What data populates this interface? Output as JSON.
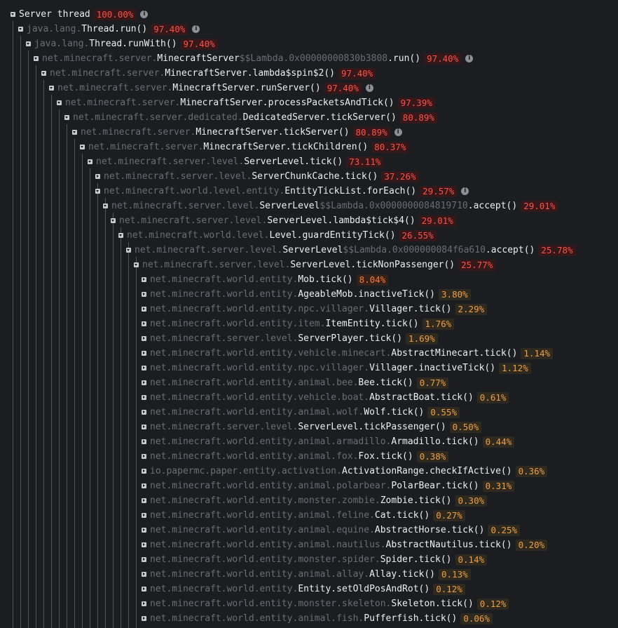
{
  "info_icon_glyph": "i",
  "colors": {
    "background": "#1b1d21",
    "percent_high": "#ff5147",
    "percent_mid": "#ff7a33",
    "percent_low": "#ee9f46",
    "package_text": "#6a6e75",
    "class_text": "#eceff2"
  },
  "nodes": [
    {
      "depth": 0,
      "expanded": true,
      "pkg": "",
      "cls": "Server thread",
      "lam": "",
      "meth": "",
      "pct": "100.00%",
      "info": true
    },
    {
      "depth": 1,
      "expanded": true,
      "pkg": "java.lang.",
      "cls": "Thread",
      "lam": "",
      "meth": ".run()",
      "pct": "97.40%",
      "info": true
    },
    {
      "depth": 2,
      "expanded": true,
      "pkg": "java.lang.",
      "cls": "Thread",
      "lam": "",
      "meth": ".runWith()",
      "pct": "97.40%",
      "info": false
    },
    {
      "depth": 3,
      "expanded": true,
      "pkg": "net.minecraft.server.",
      "cls": "MinecraftServer",
      "lam": "$$Lambda.0x00000000830b3808",
      "meth": ".run()",
      "pct": "97.40%",
      "info": true
    },
    {
      "depth": 4,
      "expanded": true,
      "pkg": "net.minecraft.server.",
      "cls": "MinecraftServer",
      "lam": "",
      "meth": ".lambda$spin$2()",
      "pct": "97.40%",
      "info": false
    },
    {
      "depth": 5,
      "expanded": true,
      "pkg": "net.minecraft.server.",
      "cls": "MinecraftServer",
      "lam": "",
      "meth": ".runServer()",
      "pct": "97.40%",
      "info": true
    },
    {
      "depth": 6,
      "expanded": true,
      "pkg": "net.minecraft.server.",
      "cls": "MinecraftServer",
      "lam": "",
      "meth": ".processPacketsAndTick()",
      "pct": "97.39%",
      "info": false
    },
    {
      "depth": 7,
      "expanded": true,
      "pkg": "net.minecraft.server.dedicated.",
      "cls": "DedicatedServer",
      "lam": "",
      "meth": ".tickServer()",
      "pct": "80.89%",
      "info": false
    },
    {
      "depth": 8,
      "expanded": true,
      "pkg": "net.minecraft.server.",
      "cls": "MinecraftServer",
      "lam": "",
      "meth": ".tickServer()",
      "pct": "80.89%",
      "info": true
    },
    {
      "depth": 9,
      "expanded": true,
      "pkg": "net.minecraft.server.",
      "cls": "MinecraftServer",
      "lam": "",
      "meth": ".tickChildren()",
      "pct": "80.37%",
      "info": false
    },
    {
      "depth": 10,
      "expanded": true,
      "pkg": "net.minecraft.server.level.",
      "cls": "ServerLevel",
      "lam": "",
      "meth": ".tick()",
      "pct": "73.11%",
      "info": false
    },
    {
      "depth": 11,
      "expanded": false,
      "pkg": "net.minecraft.server.level.",
      "cls": "ServerChunkCache",
      "lam": "",
      "meth": ".tick()",
      "pct": "37.26%",
      "info": false
    },
    {
      "depth": 11,
      "expanded": true,
      "pkg": "net.minecraft.world.level.entity.",
      "cls": "EntityTickList",
      "lam": "",
      "meth": ".forEach()",
      "pct": "29.57%",
      "info": true
    },
    {
      "depth": 12,
      "expanded": true,
      "pkg": "net.minecraft.server.level.",
      "cls": "ServerLevel",
      "lam": "$$Lambda.0x0000000084819710",
      "meth": ".accept()",
      "pct": "29.01%",
      "info": false
    },
    {
      "depth": 13,
      "expanded": true,
      "pkg": "net.minecraft.server.level.",
      "cls": "ServerLevel",
      "lam": "",
      "meth": ".lambda$tick$4()",
      "pct": "29.01%",
      "info": false
    },
    {
      "depth": 14,
      "expanded": true,
      "pkg": "net.minecraft.world.level.",
      "cls": "Level",
      "lam": "",
      "meth": ".guardEntityTick()",
      "pct": "26.55%",
      "info": false
    },
    {
      "depth": 15,
      "expanded": true,
      "pkg": "net.minecraft.server.level.",
      "cls": "ServerLevel",
      "lam": "$$Lambda.0x000000084f6a610",
      "meth": ".accept()",
      "pct": "25.78%",
      "info": false
    },
    {
      "depth": 16,
      "expanded": true,
      "pkg": "net.minecraft.server.level.",
      "cls": "ServerLevel",
      "lam": "",
      "meth": ".tickNonPassenger()",
      "pct": "25.77%",
      "info": false
    },
    {
      "depth": 17,
      "expanded": false,
      "pkg": "net.minecraft.world.entity.",
      "cls": "Mob",
      "lam": "",
      "meth": ".tick()",
      "pct": "8.04%",
      "info": false
    },
    {
      "depth": 17,
      "expanded": false,
      "pkg": "net.minecraft.world.entity.",
      "cls": "AgeableMob",
      "lam": "",
      "meth": ".inactiveTick()",
      "pct": "3.80%",
      "info": false
    },
    {
      "depth": 17,
      "expanded": false,
      "pkg": "net.minecraft.world.entity.npc.villager.",
      "cls": "Villager",
      "lam": "",
      "meth": ".tick()",
      "pct": "2.29%",
      "info": false
    },
    {
      "depth": 17,
      "expanded": false,
      "pkg": "net.minecraft.world.entity.item.",
      "cls": "ItemEntity",
      "lam": "",
      "meth": ".tick()",
      "pct": "1.76%",
      "info": false
    },
    {
      "depth": 17,
      "expanded": false,
      "pkg": "net.minecraft.server.level.",
      "cls": "ServerPlayer",
      "lam": "",
      "meth": ".tick()",
      "pct": "1.69%",
      "info": false
    },
    {
      "depth": 17,
      "expanded": false,
      "pkg": "net.minecraft.world.entity.vehicle.minecart.",
      "cls": "AbstractMinecart",
      "lam": "",
      "meth": ".tick()",
      "pct": "1.14%",
      "info": false
    },
    {
      "depth": 17,
      "expanded": false,
      "pkg": "net.minecraft.world.entity.npc.villager.",
      "cls": "Villager",
      "lam": "",
      "meth": ".inactiveTick()",
      "pct": "1.12%",
      "info": false
    },
    {
      "depth": 17,
      "expanded": false,
      "pkg": "net.minecraft.world.entity.animal.bee.",
      "cls": "Bee",
      "lam": "",
      "meth": ".tick()",
      "pct": "0.77%",
      "info": false
    },
    {
      "depth": 17,
      "expanded": false,
      "pkg": "net.minecraft.world.entity.vehicle.boat.",
      "cls": "AbstractBoat",
      "lam": "",
      "meth": ".tick()",
      "pct": "0.61%",
      "info": false
    },
    {
      "depth": 17,
      "expanded": false,
      "pkg": "net.minecraft.world.entity.animal.wolf.",
      "cls": "Wolf",
      "lam": "",
      "meth": ".tick()",
      "pct": "0.55%",
      "info": false
    },
    {
      "depth": 17,
      "expanded": false,
      "pkg": "net.minecraft.server.level.",
      "cls": "ServerLevel",
      "lam": "",
      "meth": ".tickPassenger()",
      "pct": "0.50%",
      "info": false
    },
    {
      "depth": 17,
      "expanded": false,
      "pkg": "net.minecraft.world.entity.animal.armadillo.",
      "cls": "Armadillo",
      "lam": "",
      "meth": ".tick()",
      "pct": "0.44%",
      "info": false
    },
    {
      "depth": 17,
      "expanded": false,
      "pkg": "net.minecraft.world.entity.animal.fox.",
      "cls": "Fox",
      "lam": "",
      "meth": ".tick()",
      "pct": "0.38%",
      "info": false
    },
    {
      "depth": 17,
      "expanded": false,
      "pkg": "io.papermc.paper.entity.activation.",
      "cls": "ActivationRange",
      "lam": "",
      "meth": ".checkIfActive()",
      "pct": "0.36%",
      "info": false
    },
    {
      "depth": 17,
      "expanded": false,
      "pkg": "net.minecraft.world.entity.animal.polarbear.",
      "cls": "PolarBear",
      "lam": "",
      "meth": ".tick()",
      "pct": "0.31%",
      "info": false
    },
    {
      "depth": 17,
      "expanded": false,
      "pkg": "net.minecraft.world.entity.monster.zombie.",
      "cls": "Zombie",
      "lam": "",
      "meth": ".tick()",
      "pct": "0.30%",
      "info": false
    },
    {
      "depth": 17,
      "expanded": false,
      "pkg": "net.minecraft.world.entity.animal.feline.",
      "cls": "Cat",
      "lam": "",
      "meth": ".tick()",
      "pct": "0.27%",
      "info": false
    },
    {
      "depth": 17,
      "expanded": false,
      "pkg": "net.minecraft.world.entity.animal.equine.",
      "cls": "AbstractHorse",
      "lam": "",
      "meth": ".tick()",
      "pct": "0.25%",
      "info": false
    },
    {
      "depth": 17,
      "expanded": false,
      "pkg": "net.minecraft.world.entity.animal.nautilus.",
      "cls": "AbstractNautilus",
      "lam": "",
      "meth": ".tick()",
      "pct": "0.20%",
      "info": false
    },
    {
      "depth": 17,
      "expanded": false,
      "pkg": "net.minecraft.world.entity.monster.spider.",
      "cls": "Spider",
      "lam": "",
      "meth": ".tick()",
      "pct": "0.14%",
      "info": false
    },
    {
      "depth": 17,
      "expanded": false,
      "pkg": "net.minecraft.world.entity.animal.allay.",
      "cls": "Allay",
      "lam": "",
      "meth": ".tick()",
      "pct": "0.13%",
      "info": false
    },
    {
      "depth": 17,
      "expanded": false,
      "pkg": "net.minecraft.world.entity.",
      "cls": "Entity",
      "lam": "",
      "meth": ".setOldPosAndRot()",
      "pct": "0.12%",
      "info": false
    },
    {
      "depth": 17,
      "expanded": false,
      "pkg": "net.minecraft.world.entity.monster.skeleton.",
      "cls": "Skeleton",
      "lam": "",
      "meth": ".tick()",
      "pct": "0.12%",
      "info": false
    },
    {
      "depth": 17,
      "expanded": false,
      "pkg": "net.minecraft.world.entity.animal.fish.",
      "cls": "Pufferfish",
      "lam": "",
      "meth": ".tick()",
      "pct": "0.06%",
      "info": false
    }
  ]
}
